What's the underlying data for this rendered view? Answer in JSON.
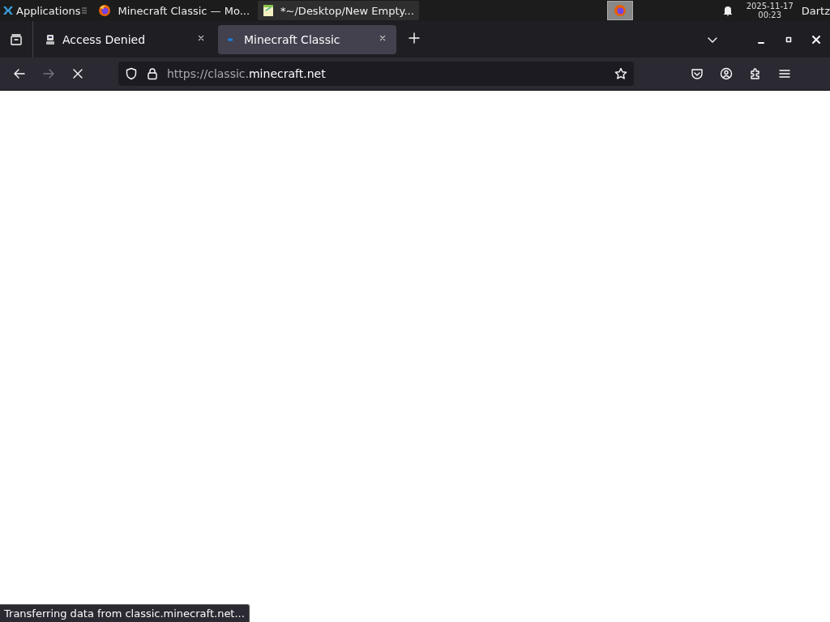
{
  "taskbar": {
    "launcher": "Applications",
    "tasks": [
      {
        "kind": "browser",
        "label": "Minecraft Classic — Mo...",
        "selected": false
      },
      {
        "kind": "editor",
        "label": "*~/Desktop/New Empty...",
        "selected": true
      }
    ],
    "clock": {
      "date": "2025-11-17",
      "time": "00:23"
    },
    "user": "Dartz"
  },
  "tabs": [
    {
      "kind": "blocked",
      "label": "Access Denied",
      "selected": false
    },
    {
      "kind": "loading",
      "label": "Minecraft Classic",
      "selected": true
    }
  ],
  "address_bar": {
    "url_scheme": "https://classic.",
    "url_host": "minecraft.net"
  },
  "status_bar": "Transferring data from classic.minecraft.net..."
}
